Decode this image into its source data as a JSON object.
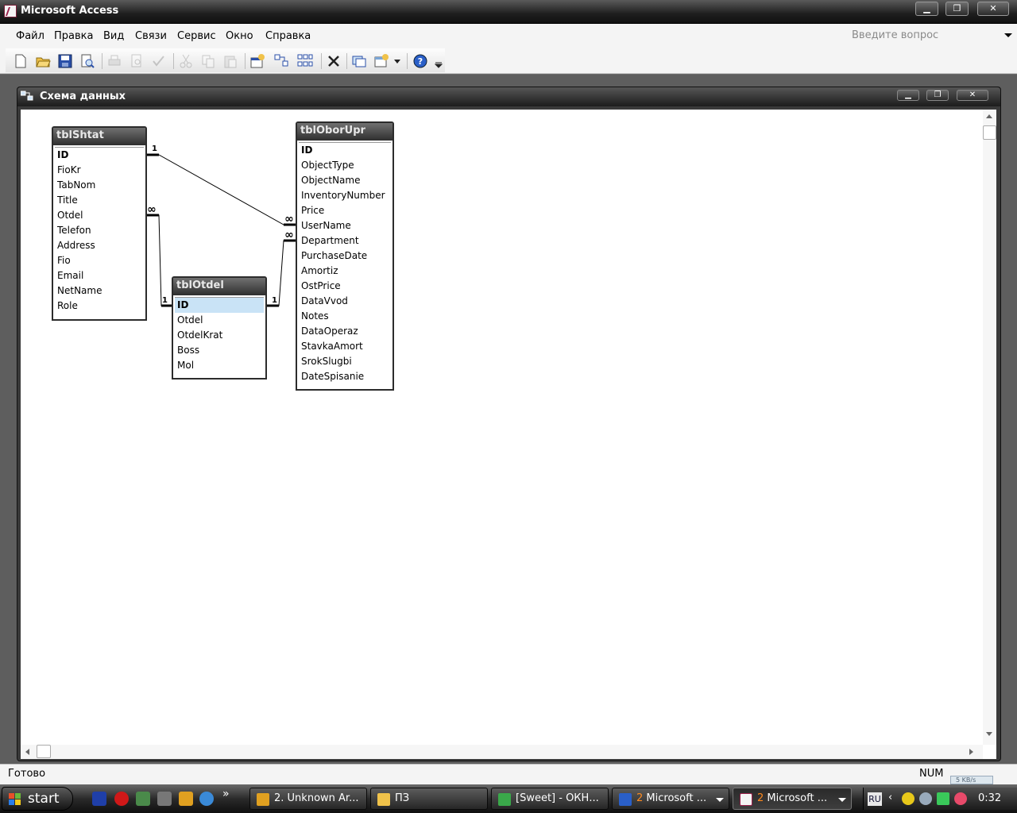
{
  "app": {
    "title": "Microsoft Access",
    "question_placeholder": "Введите вопрос"
  },
  "menu": [
    "Файл",
    "Правка",
    "Вид",
    "Связи",
    "Сервис",
    "Окно",
    "Справка"
  ],
  "child_window": {
    "title": "Схема данных"
  },
  "tables": {
    "shtat": {
      "name": "tblShtat",
      "fields": [
        "ID",
        "FioKr",
        "TabNom",
        "Title",
        "Otdel",
        "Telefon",
        "Address",
        "Fio",
        "Email",
        "NetName",
        "Role"
      ]
    },
    "otdel": {
      "name": "tblOtdel",
      "fields": [
        "ID",
        "Otdel",
        "OtdelKrat",
        "Boss",
        "Mol"
      ]
    },
    "obor": {
      "name": "tblOborUpr",
      "fields": [
        "ID",
        "ObjectType",
        "ObjectName",
        "InventoryNumber",
        "Price",
        "UserName",
        "Department",
        "PurchaseDate",
        "Amortiz",
        "OstPrice",
        "DataVvod",
        "Notes",
        "DataOperaz",
        "StavkaAmort",
        "SrokSlugbi",
        "DateSpisanie"
      ]
    }
  },
  "relationship_labels": {
    "one": "1",
    "many": "∞"
  },
  "status": {
    "text": "Готово",
    "num": "NUM"
  },
  "taskbar": {
    "start": "start",
    "more": "»",
    "tasks": [
      {
        "count": "2.",
        "label": "Unknown Ar..."
      },
      {
        "count": "",
        "label": "ПЗ"
      },
      {
        "count": "",
        "label": "[Sweet] - ОКН..."
      },
      {
        "count": "2",
        "label": "Microsoft ..."
      },
      {
        "count": "2",
        "label": "Microsoft ..."
      }
    ],
    "lang": "RU",
    "chevron": "‹",
    "clock": "0:32",
    "net_speed": "5 KB/s"
  }
}
